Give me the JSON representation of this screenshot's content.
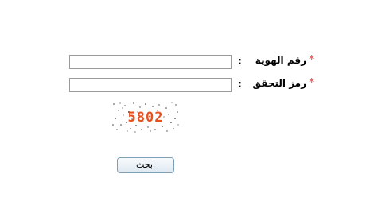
{
  "form": {
    "id_number": {
      "label": "رقم الهوية",
      "colon": ":",
      "required_mark": "*",
      "value": ""
    },
    "verification_code": {
      "label": "رمز التحقق",
      "colon": ":",
      "required_mark": "*",
      "value": ""
    },
    "captcha": {
      "text": "5802",
      "color": "#e8501e"
    },
    "search_button": {
      "label": "ابحث"
    }
  }
}
